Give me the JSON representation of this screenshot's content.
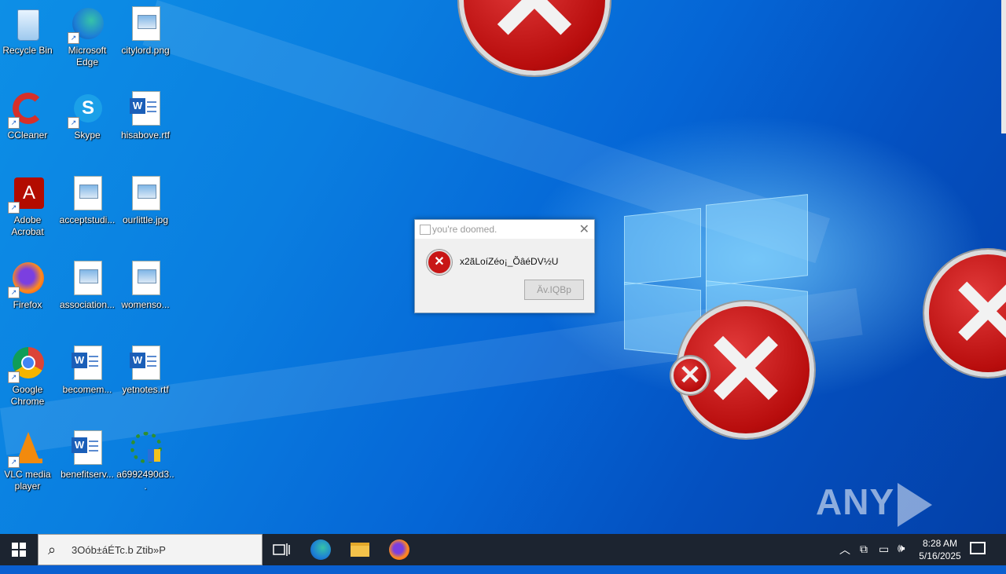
{
  "desktop": {
    "icons": [
      {
        "label": "Recycle Bin",
        "icon": "recycle-bin-icon"
      },
      {
        "label": "Microsoft Edge",
        "icon": "edge-icon"
      },
      {
        "label": "citylord.png",
        "icon": "image-file-icon"
      },
      {
        "label": "CCleaner",
        "icon": "ccleaner-icon"
      },
      {
        "label": "Skype",
        "icon": "skype-icon"
      },
      {
        "label": "hisabove.rtf",
        "icon": "word-document-icon"
      },
      {
        "label": "Adobe Acrobat",
        "icon": "acrobat-icon"
      },
      {
        "label": "acceptstudi...",
        "icon": "image-file-icon"
      },
      {
        "label": "ourlittle.jpg",
        "icon": "image-file-icon"
      },
      {
        "label": "Firefox",
        "icon": "firefox-icon"
      },
      {
        "label": "association...",
        "icon": "image-file-icon"
      },
      {
        "label": "womenso...",
        "icon": "image-file-icon"
      },
      {
        "label": "Google Chrome",
        "icon": "chrome-icon"
      },
      {
        "label": "becomem...",
        "icon": "word-document-icon"
      },
      {
        "label": "yetnotes.rtf",
        "icon": "word-document-icon"
      },
      {
        "label": "VLC media player",
        "icon": "vlc-icon"
      },
      {
        "label": "benefitserv...",
        "icon": "word-document-icon"
      },
      {
        "label": "a6992490d3...",
        "icon": "installer-icon"
      }
    ]
  },
  "dialog": {
    "title": "you're doomed.",
    "message": "x2ãLoíZéo¡_ÕâéDV½U",
    "button": "Äv.IQBp"
  },
  "watermark": {
    "text_left": "ANY",
    "text_right": "RUN"
  },
  "taskbar": {
    "search_text": "3Oób±áÉTc.b Ztib»P",
    "clock_time": "8:28 AM",
    "clock_date": "5/16/2025"
  },
  "colors": {
    "error_red": "#c81616",
    "taskbar": "#1c2430",
    "accent": "#0a7ee0"
  }
}
